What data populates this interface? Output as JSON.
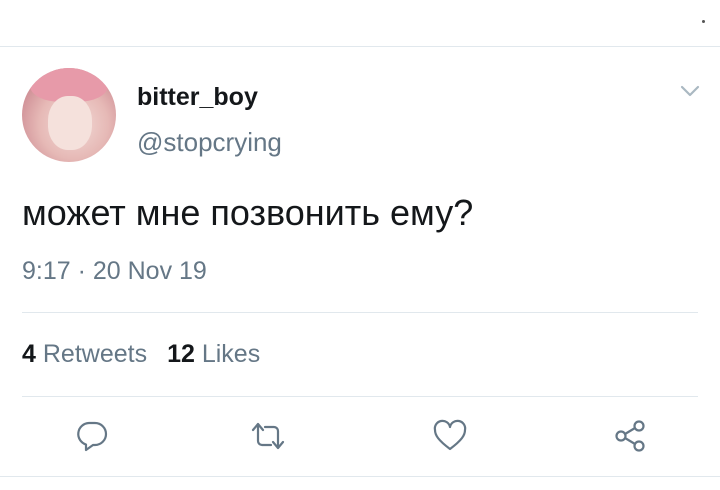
{
  "tweet": {
    "display_name": "bitter_boy",
    "handle": "@stopcrying",
    "text": "может мне позвонить ему?",
    "timestamp": "9:17 · 20 Nov 19"
  },
  "stats": {
    "retweets_count": "4",
    "retweets_label": "Retweets",
    "likes_count": "12",
    "likes_label": "Likes"
  },
  "icons": {
    "menu": "chevron-down-icon",
    "reply": "reply-icon",
    "retweet": "retweet-icon",
    "like": "heart-icon",
    "share": "share-icon"
  },
  "colors": {
    "text_primary": "#14171a",
    "text_secondary": "#657786",
    "divider": "#e1e8ed"
  }
}
